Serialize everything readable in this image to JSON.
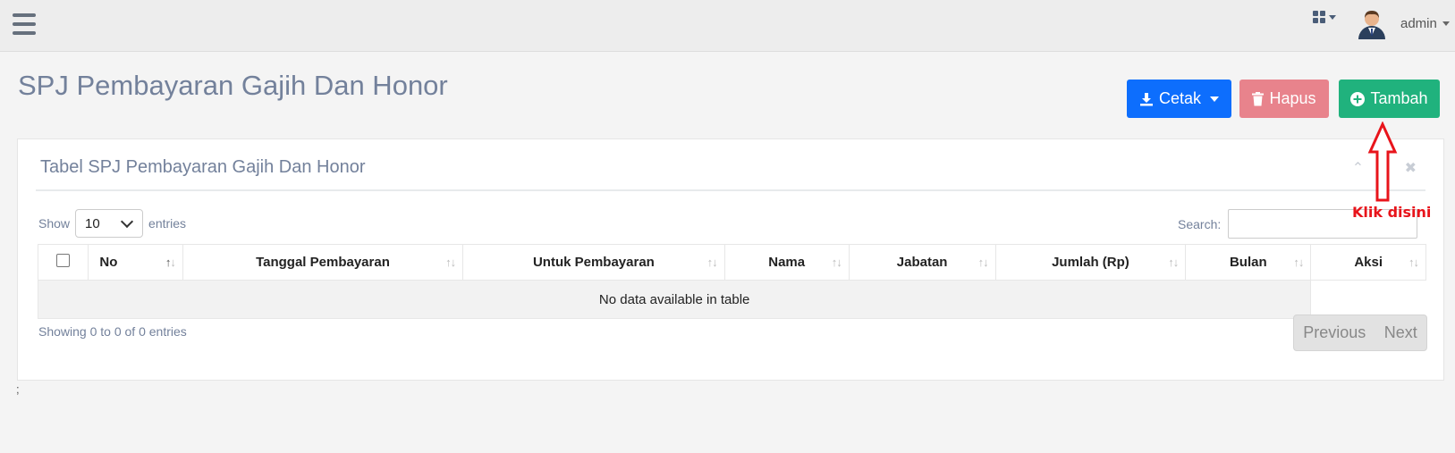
{
  "topbar": {
    "menu_icon": "hamburger-menu-icon",
    "apps_icon": "grid-icon",
    "user_name": "admin"
  },
  "page": {
    "title": "SPJ Pembayaran Gajih Dan Honor"
  },
  "actions": {
    "cetak_label": "Cetak",
    "hapus_label": "Hapus",
    "tambah_label": "Tambah",
    "colors": {
      "cetak": "#0d6efd",
      "hapus": "#e8838c",
      "tambah": "#20b27d"
    }
  },
  "panel": {
    "title": "Tabel SPJ Pembayaran Gajih Dan Honor",
    "tools": [
      "chevron-up-icon",
      "wrench-icon",
      "close-icon"
    ]
  },
  "table_controls": {
    "show_label": "Show",
    "entries_value": "10",
    "entries_label": "entries",
    "search_label": "Search:"
  },
  "table": {
    "columns": [
      "No",
      "Tanggal Pembayaran",
      "Untuk Pembayaran",
      "Nama",
      "Jabatan",
      "Jumlah (Rp)",
      "Bulan",
      "Aksi"
    ],
    "empty_message": "No data available in table"
  },
  "footer": {
    "info": "Showing 0 to 0 of 0 entries",
    "previous": "Previous",
    "next": "Next",
    "note": ";"
  },
  "annotation": {
    "text": "Klik disini",
    "color": "#e8141b"
  }
}
